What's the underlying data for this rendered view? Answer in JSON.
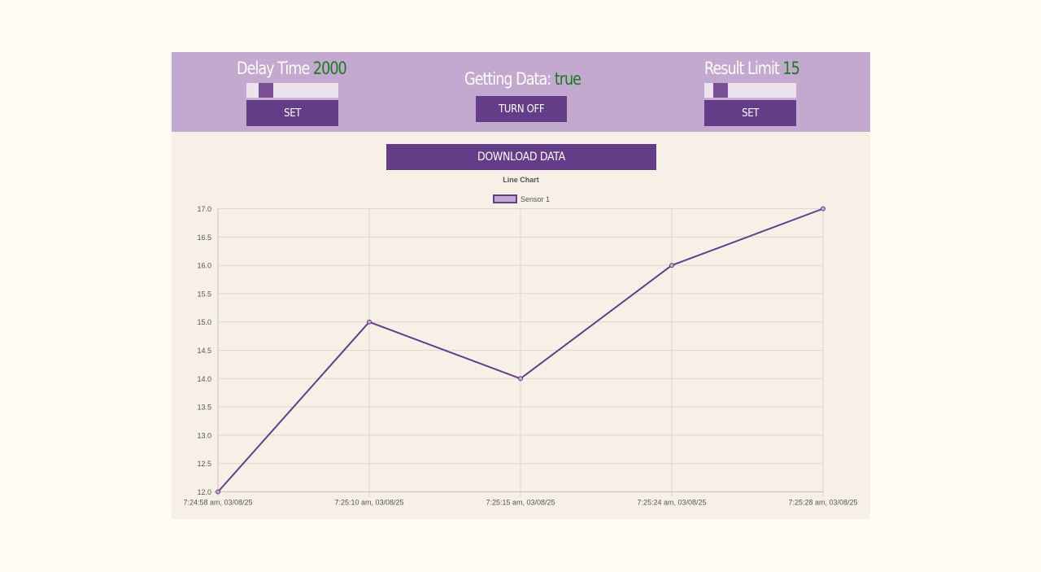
{
  "controls": {
    "delay": {
      "title": "Delay Time",
      "value": "2000",
      "slider_fraction": 0.16,
      "set_label": "SET"
    },
    "getting": {
      "title": "Getting Data:",
      "value": "true",
      "toggle_label": "TURN OFF"
    },
    "limit": {
      "title": "Result Limit",
      "value": "15",
      "slider_fraction": 0.12,
      "set_label": "SET"
    }
  },
  "download_label": "DOWNLOAD DATA",
  "colors": {
    "accent": "#643d88",
    "topbar": "#c3a8d0",
    "value_green": "#1b7a1b",
    "line": "#643d88",
    "legend_fill": "#c3a8d0"
  },
  "chart_data": {
    "type": "line",
    "title": "Line Chart",
    "x": [
      "7:24:58 am, 03/08/25",
      "7:25:10 am, 03/08/25",
      "7:25:15 am, 03/08/25",
      "7:25:24 am, 03/08/25",
      "7:25:28 am, 03/08/25"
    ],
    "series": [
      {
        "name": "Sensor 1",
        "values": [
          12,
          15,
          14,
          16,
          17
        ]
      }
    ],
    "ylim": [
      12,
      17
    ],
    "yticks": [
      "12.0",
      "12.5",
      "13.0",
      "13.5",
      "14.0",
      "14.5",
      "15.0",
      "15.5",
      "16.0",
      "16.5",
      "17.0"
    ],
    "grid": true,
    "legend": "top-center"
  }
}
